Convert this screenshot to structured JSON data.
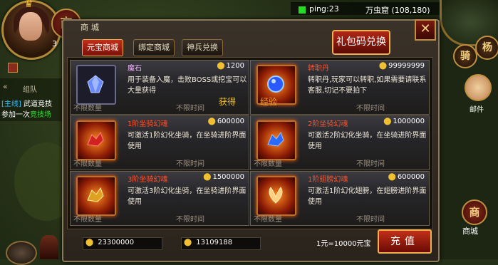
{
  "hud": {
    "ping": "ping:23",
    "location": "万虫窟 (108,180)",
    "left_shop_icon": "商",
    "side_num": "3",
    "team": "组队",
    "task_tag": "[主线]",
    "task_name": "武道竞技",
    "task_join": "参加一次",
    "task_link": "竞技场",
    "ride_btn": "骑",
    "hide_btn": "杨",
    "mail": "邮件",
    "shop_icon": "商",
    "shop_label": "商城"
  },
  "dialog": {
    "title": "商城",
    "close": "✕",
    "tabs": [
      "元宝商城",
      "绑定商城",
      "神兵兑换"
    ],
    "gift_code": "礼包码兑换",
    "float_get": "获得",
    "float_exp": "经验",
    "items": [
      {
        "name": "魔石",
        "price": "1200",
        "desc": "用于装备入魔，击败BOSS或挖宝可以大量获得",
        "qty": "不限数量",
        "time": "不限时间",
        "icon": "gem-icon"
      },
      {
        "name": "转职丹",
        "price": "99999999",
        "desc": "转职丹,玩家可以转职,如果需要请联系客服,切记不要拍下",
        "qty": "",
        "time": "不限时间",
        "icon": "orb-icon"
      },
      {
        "name": "1阶坐骑幻魂",
        "price": "600000",
        "desc": "可激活1阶幻化坐骑，在坐骑进阶界面使用",
        "qty": "不限数量",
        "time": "不限时间",
        "icon": "dragon-mount-icon"
      },
      {
        "name": "2阶坐骑幻魂",
        "price": "1000000",
        "desc": "可激活2阶幻化坐骑，在坐骑进阶界面使用",
        "qty": "不限数量",
        "time": "不限时间",
        "icon": "blue-mount-icon"
      },
      {
        "name": "3阶坐骑幻魂",
        "price": "1500000",
        "desc": "可激活3阶幻化坐骑，在坐骑进阶界面使用",
        "qty": "不限数量",
        "time": "不限时间",
        "icon": "golden-mount-icon"
      },
      {
        "name": "1阶翅膀幻魂",
        "price": "600000",
        "desc": "可激活1阶幻化翅膀，在翅膀进阶界面使用",
        "qty": "不限数量",
        "time": "不限时间",
        "icon": "wing-icon"
      }
    ],
    "yuanbao": "23300000",
    "bound_yuanbao": "13109188",
    "rate": "1元=10000元宝",
    "recharge": "充值"
  }
}
